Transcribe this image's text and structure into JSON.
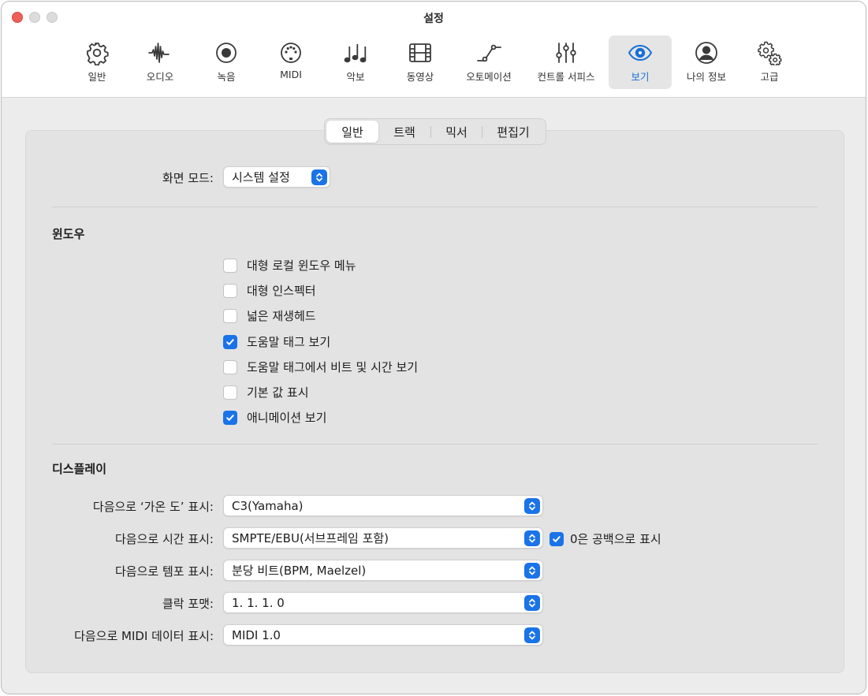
{
  "window": {
    "title": "설정"
  },
  "toolbar": [
    {
      "label": "일반",
      "icon": "gear-icon"
    },
    {
      "label": "오디오",
      "icon": "waveform-icon"
    },
    {
      "label": "녹음",
      "icon": "record-icon"
    },
    {
      "label": "MIDI",
      "icon": "midi-port-icon"
    },
    {
      "label": "악보",
      "icon": "music-notes-icon"
    },
    {
      "label": "동영상",
      "icon": "film-icon"
    },
    {
      "label": "오토메이션",
      "icon": "automation-curve-icon"
    },
    {
      "label": "컨트롤 서피스",
      "icon": "sliders-icon"
    },
    {
      "label": "보기",
      "icon": "eye-icon",
      "active": true
    },
    {
      "label": "나의 정보",
      "icon": "person-circle-icon"
    },
    {
      "label": "고급",
      "icon": "gears-icon"
    }
  ],
  "tabs": {
    "general": "일반",
    "track": "트랙",
    "mixer": "믹서",
    "editor": "편집기",
    "selected": "일반"
  },
  "screen_mode": {
    "label": "화면 모드:",
    "value": "시스템 설정"
  },
  "windows_section": {
    "title": "윈도우",
    "options": [
      {
        "label": "대형 로컬 윈도우 메뉴",
        "checked": false
      },
      {
        "label": "대형 인스펙터",
        "checked": false
      },
      {
        "label": "넓은 재생헤드",
        "checked": false
      },
      {
        "label": "도움말 태그 보기",
        "checked": true
      },
      {
        "label": "도움말 태그에서 비트 및 시간 보기",
        "checked": false
      },
      {
        "label": "기본 값 표시",
        "checked": false
      },
      {
        "label": "애니메이션 보기",
        "checked": true
      }
    ]
  },
  "display_section": {
    "title": "디스플레이",
    "middle_c": {
      "label": "다음으로 ‘가온 도’ 표시:",
      "value": "C3(Yamaha)"
    },
    "time": {
      "label": "다음으로 시간 표시:",
      "value": "SMPTE/EBU(서브프레임 포함)"
    },
    "zero_as_space": {
      "label": "0은 공백으로 표시",
      "checked": true
    },
    "tempo": {
      "label": "다음으로 템포 표시:",
      "value": "분당 비트(BPM, Maelzel)"
    },
    "clock": {
      "label": "클락 포맷:",
      "value": "1. 1. 1. 0"
    },
    "midi_data": {
      "label": "다음으로 MIDI 데이터 표시:",
      "value": "MIDI 1.0"
    }
  },
  "colors": {
    "accent": "#1a73e8",
    "close": "#ee5f56"
  }
}
